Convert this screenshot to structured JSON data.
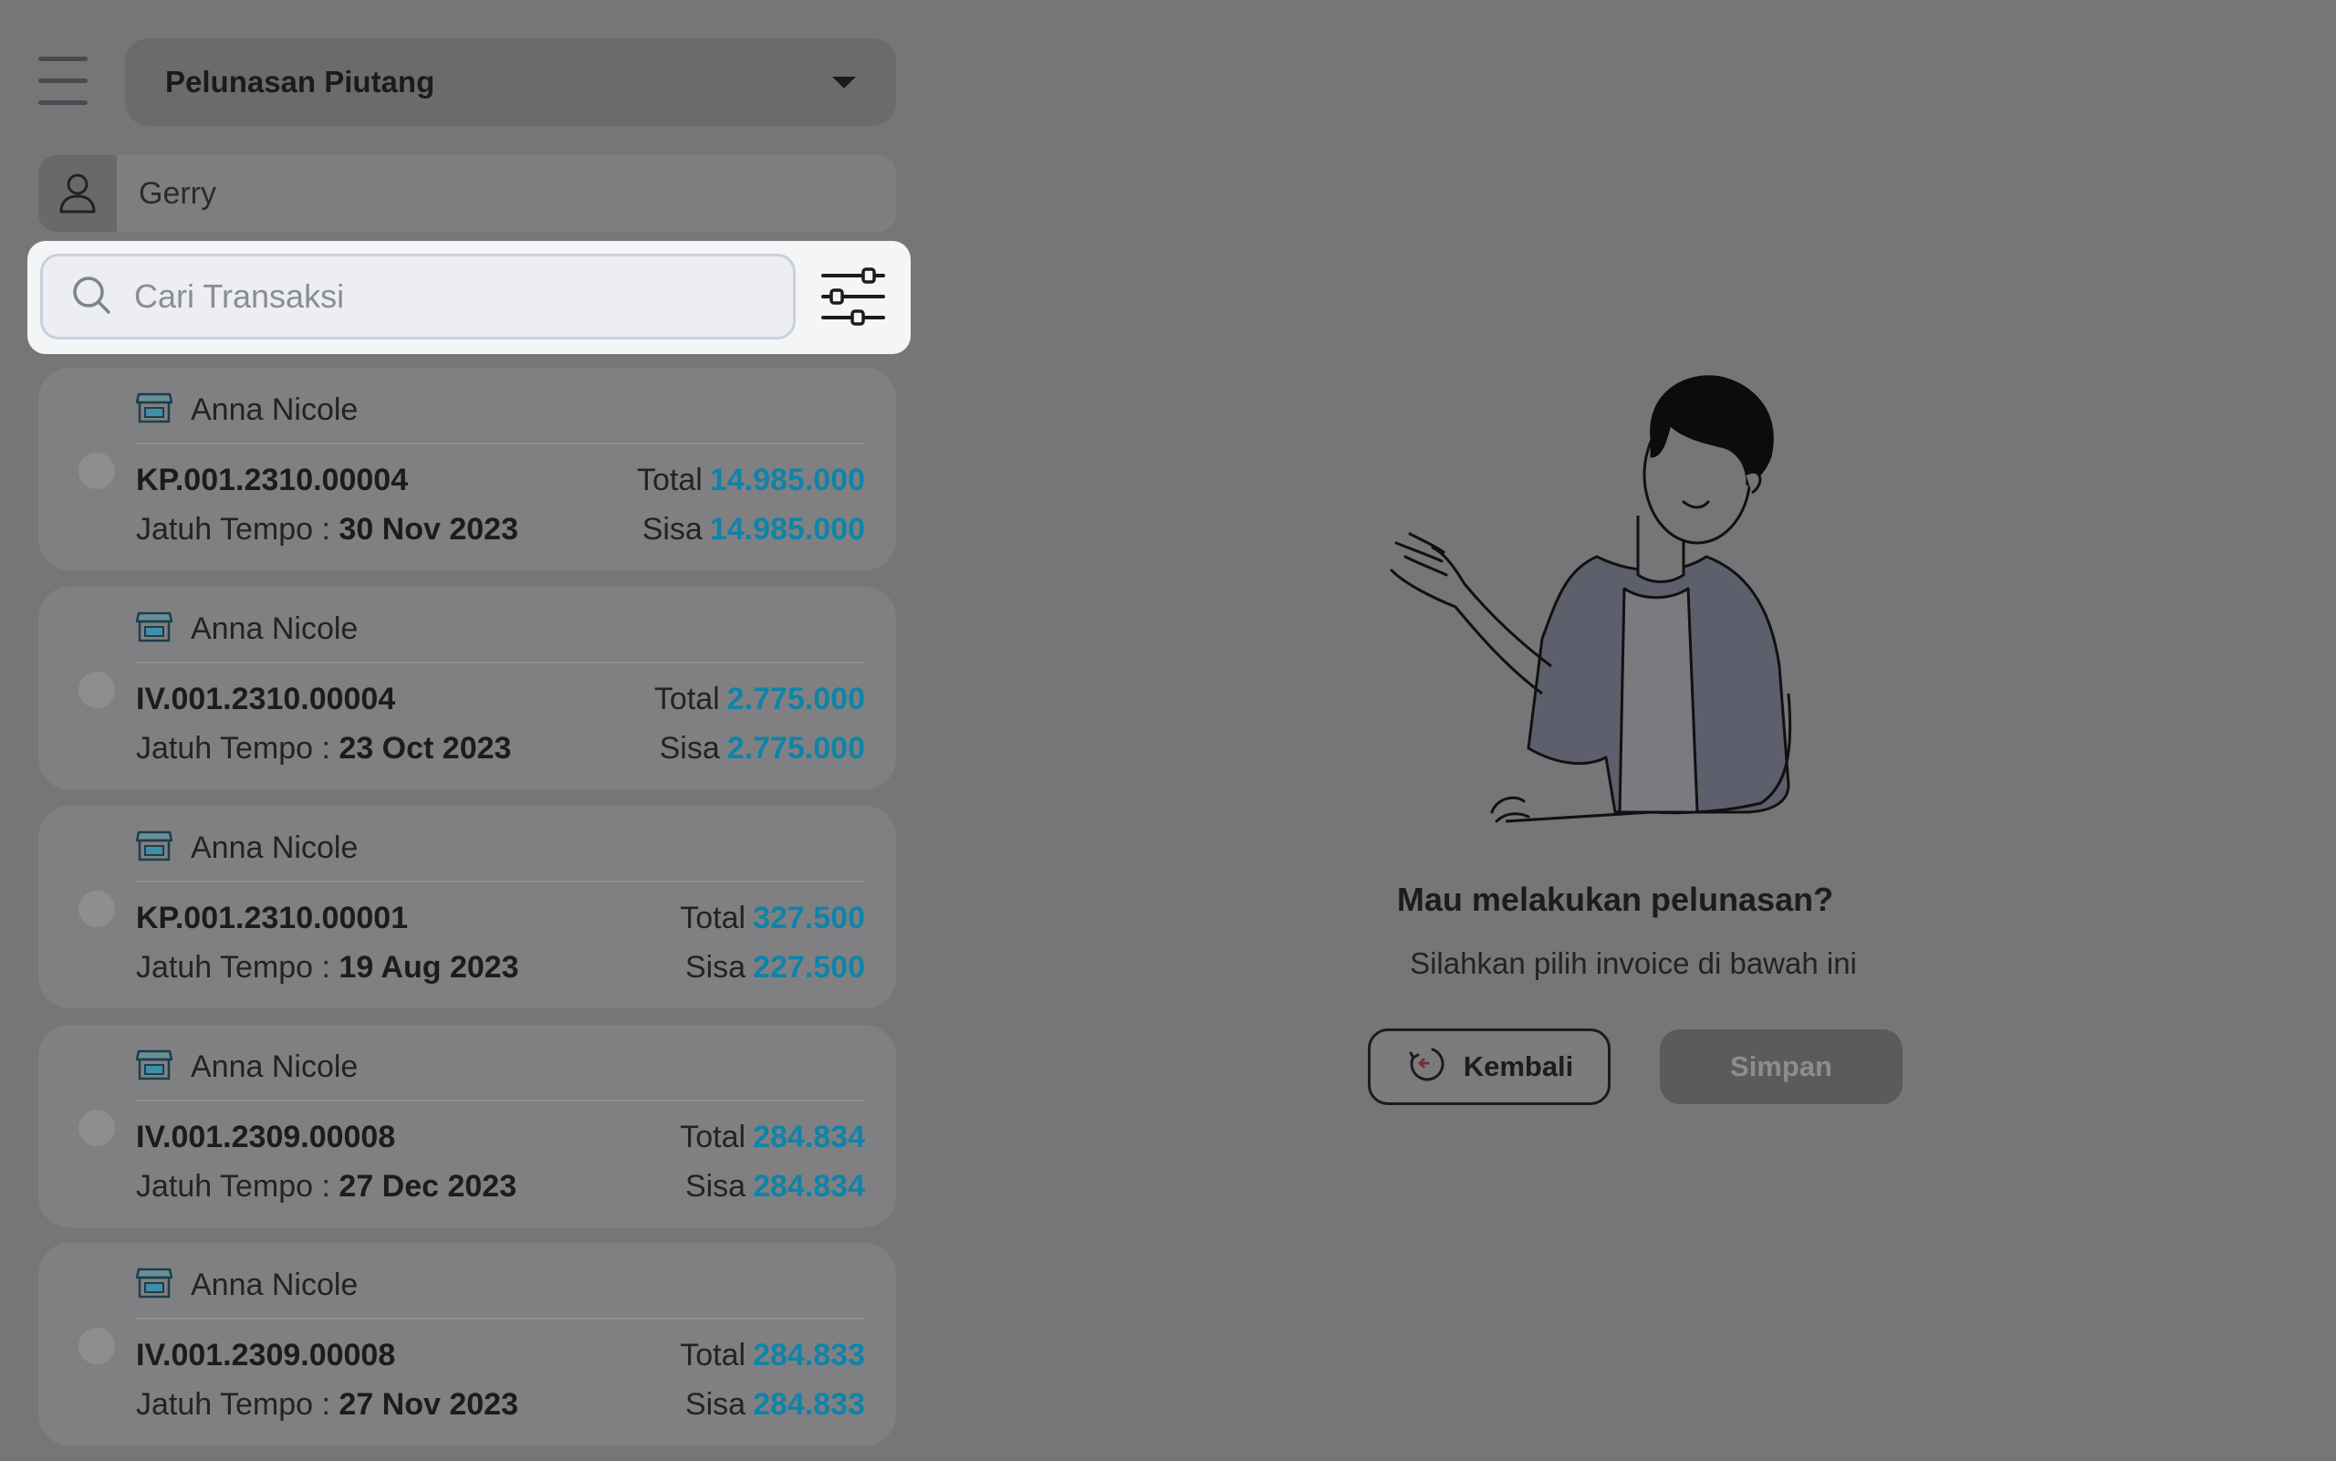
{
  "header": {
    "menu_icon": "hamburger-menu-icon",
    "dropdown_selected": "Pelunasan Piutang"
  },
  "customer": {
    "icon": "user-icon",
    "name": "Gerry"
  },
  "search": {
    "placeholder": "Cari Transaksi",
    "value": "",
    "icon": "search-icon",
    "filter_icon": "filter-sliders-icon"
  },
  "transactions": [
    {
      "store": "Anna Nicole",
      "invoice": "KP.001.2310.00004",
      "due_label": "Jatuh Tempo : ",
      "due_date": "30 Nov 2023",
      "total_label": "Total",
      "total": "14.985.000",
      "remaining_label": "Sisa",
      "remaining": "14.985.000"
    },
    {
      "store": "Anna Nicole",
      "invoice": "IV.001.2310.00004",
      "due_label": "Jatuh Tempo : ",
      "due_date": "23 Oct 2023",
      "total_label": "Total",
      "total": "2.775.000",
      "remaining_label": "Sisa",
      "remaining": "2.775.000"
    },
    {
      "store": "Anna Nicole",
      "invoice": "KP.001.2310.00001",
      "due_label": "Jatuh Tempo : ",
      "due_date": "19 Aug 2023",
      "total_label": "Total",
      "total": "327.500",
      "remaining_label": "Sisa",
      "remaining": "227.500"
    },
    {
      "store": "Anna Nicole",
      "invoice": "IV.001.2309.00008",
      "due_label": "Jatuh Tempo : ",
      "due_date": "27 Dec 2023",
      "total_label": "Total",
      "total": "284.834",
      "remaining_label": "Sisa",
      "remaining": "284.834"
    },
    {
      "store": "Anna Nicole",
      "invoice": "IV.001.2309.00008",
      "due_label": "Jatuh Tempo : ",
      "due_date": "27 Nov 2023",
      "total_label": "Total",
      "total": "284.833",
      "remaining_label": "Sisa",
      "remaining": "284.833"
    }
  ],
  "empty_state": {
    "illustration": "man-waving-illustration",
    "title": "Mau melakukan pelunasan?",
    "subtitle": "Silahkan pilih invoice di bawah ini"
  },
  "actions": {
    "back_label": "Kembali",
    "back_icon": "back-arrow-circle-icon",
    "save_label": "Simpan",
    "save_enabled": false
  },
  "colors": {
    "accent": "#0f84a8",
    "overlay": "#767679"
  }
}
